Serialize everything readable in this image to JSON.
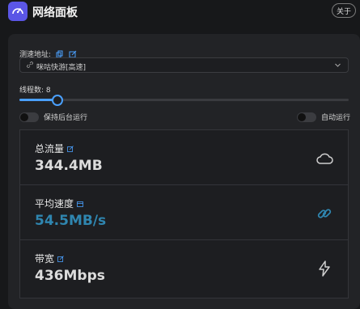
{
  "app": {
    "title": "网络面板",
    "about_label": "关于"
  },
  "speedtest": {
    "address_label": "测速地址:",
    "address_value": "咪咕快游[高速]",
    "threads_label": "线程数: 8",
    "threads_fraction": 0.11
  },
  "toggles": {
    "keep_background_label": "保持后台运行",
    "auto_run_label": "自动运行"
  },
  "stats": {
    "total": {
      "title": "总流量",
      "value": "344.4MB"
    },
    "avg_speed": {
      "title": "平均速度",
      "value": "54.5MB/s"
    },
    "bandwidth": {
      "title": "带宽",
      "value": "436Mbps"
    }
  },
  "colors": {
    "accent": "#4aa0ff",
    "logo": "#5b56e6",
    "speed_value": "#2f86b0"
  },
  "icons": [
    "speedometer-icon",
    "copy-icon",
    "edit-icon",
    "link-icon",
    "chevron-down-icon",
    "cloud-icon",
    "link-chain-icon",
    "lightning-icon",
    "external-edit-icon",
    "calendar-icon"
  ]
}
